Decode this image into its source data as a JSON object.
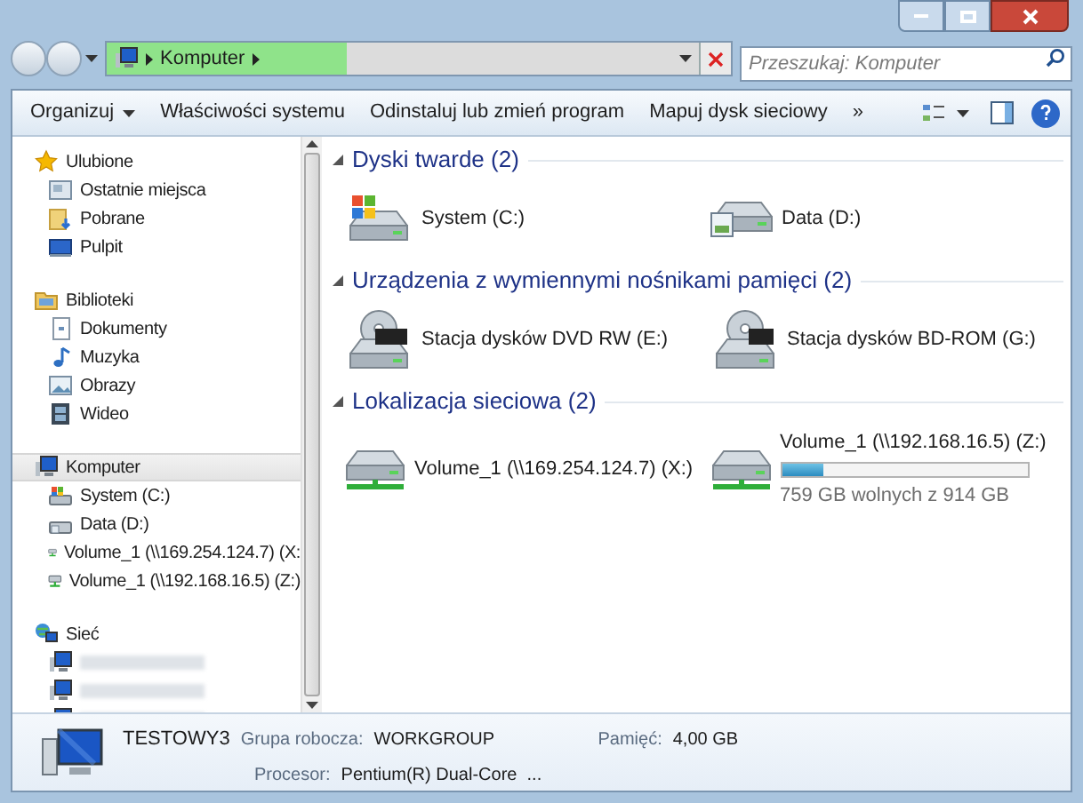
{
  "address": {
    "crumbs": [
      "Komputer"
    ]
  },
  "search": {
    "placeholder": "Przeszukaj: Komputer"
  },
  "toolbar": [
    {
      "label": "Organizuj",
      "kind": "dropdown"
    },
    {
      "label": "Właściwości systemu",
      "kind": "button"
    },
    {
      "label": "Odinstaluj lub zmień program",
      "kind": "button"
    },
    {
      "label": "Mapuj dysk sieciowy",
      "kind": "button"
    },
    {
      "label": "»",
      "kind": "button"
    }
  ],
  "sidebar": [
    {
      "label": "Ulubione",
      "kind": "star",
      "selected": false,
      "children": [
        {
          "label": "Ostatnie miejsca",
          "kind": "recent",
          "selected": false
        },
        {
          "label": "Pobrane",
          "kind": "download",
          "selected": false
        },
        {
          "label": "Pulpit",
          "kind": "desktop",
          "selected": false
        }
      ]
    },
    {
      "label": "Biblioteki",
      "kind": "library",
      "selected": false,
      "children": [
        {
          "label": "Dokumenty",
          "kind": "document",
          "selected": false
        },
        {
          "label": "Muzyka",
          "kind": "music",
          "selected": false
        },
        {
          "label": "Obrazy",
          "kind": "picture",
          "selected": false
        },
        {
          "label": "Wideo",
          "kind": "video",
          "selected": false
        }
      ]
    },
    {
      "label": "Komputer",
      "kind": "computer",
      "selected": true,
      "children": [
        {
          "label": "System (C:)",
          "kind": "system",
          "selected": false
        },
        {
          "label": "Data (D:)",
          "kind": "data",
          "selected": false
        },
        {
          "label": "Volume_1 (\\\\169.254.124.7) (X:",
          "kind": "network",
          "selected": false
        },
        {
          "label": "Volume_1 (\\\\192.168.16.5) (Z:)",
          "kind": "network",
          "selected": false
        }
      ]
    },
    {
      "label": "Sieć",
      "kind": "globe",
      "selected": false,
      "children": [
        {
          "kind": "blurred"
        },
        {
          "kind": "blurred"
        },
        {
          "kind": "blurred"
        }
      ]
    }
  ],
  "sections": [
    {
      "title": "Dyski twarde (2)",
      "items": [
        {
          "label": "System (C:)",
          "kind": "system"
        },
        {
          "label": "Data (D:)",
          "kind": "data"
        }
      ]
    },
    {
      "title": "Urządzenia z wymiennymi nośnikami pamięci (2)",
      "items": [
        {
          "label": "Stacja dysków DVD RW (E:)",
          "kind": "dvd"
        },
        {
          "label": "Stacja dysków BD-ROM (G:)",
          "kind": "bd"
        }
      ]
    },
    {
      "title": "Lokalizacja sieciowa (2)",
      "items": [
        {
          "label": "Volume_1 (\\\\169.254.124.7) (X:)",
          "kind": "network"
        },
        {
          "label": "Volume_1 (\\\\192.168.16.5) (Z:)",
          "kind": "network",
          "level": 0.17,
          "reading": "759 GB wolnych z 914 GB"
        }
      ]
    }
  ],
  "details": {
    "name": "TESTOWY3",
    "fields": [
      {
        "label": "Grupa robocza:",
        "value": "WORKGROUP"
      },
      {
        "label": "Pamięć:",
        "value": "4,00 GB"
      },
      {
        "label": "Procesor:",
        "value": "Pentium(R) Dual-Core  ..."
      }
    ]
  }
}
